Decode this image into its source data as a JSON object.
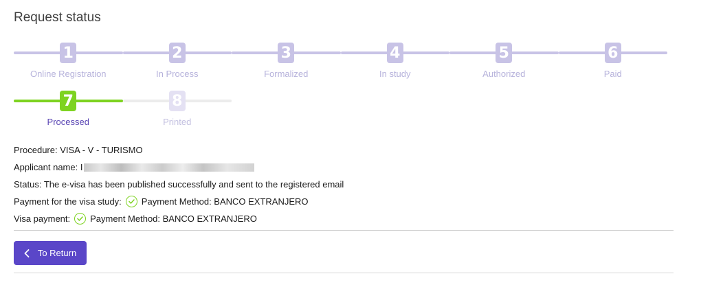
{
  "page": {
    "title": "Request status"
  },
  "steps": [
    {
      "number": "1",
      "label": "Online Registration",
      "state": "completed"
    },
    {
      "number": "2",
      "label": "In Process",
      "state": "completed"
    },
    {
      "number": "3",
      "label": "Formalized",
      "state": "completed"
    },
    {
      "number": "4",
      "label": "In study",
      "state": "completed"
    },
    {
      "number": "5",
      "label": "Authorized",
      "state": "completed"
    },
    {
      "number": "6",
      "label": "Paid",
      "state": "completed"
    },
    {
      "number": "7",
      "label": "Processed",
      "state": "current"
    },
    {
      "number": "8",
      "label": "Printed",
      "state": "pending"
    }
  ],
  "details": {
    "procedure": "Procedure: VISA - V - TURISMO",
    "applicant_label": "Applicant name: I",
    "status": "Status: The e-visa has been published successfully and sent to the registered email",
    "study_payment_label": "Payment for the visa study:",
    "study_payment_method": "Payment Method: BANCO EXTRANJERO",
    "visa_payment_label": "Visa payment:",
    "visa_payment_method": "Payment Method: BANCO EXTRANJERO"
  },
  "actions": {
    "return_label": "To Return"
  },
  "colors": {
    "accent": "#5a46c8",
    "done": "#7ed321",
    "step": "#c8c3e6"
  },
  "icons": {
    "paid": "check-circle-icon",
    "back": "chevron-left-icon"
  }
}
